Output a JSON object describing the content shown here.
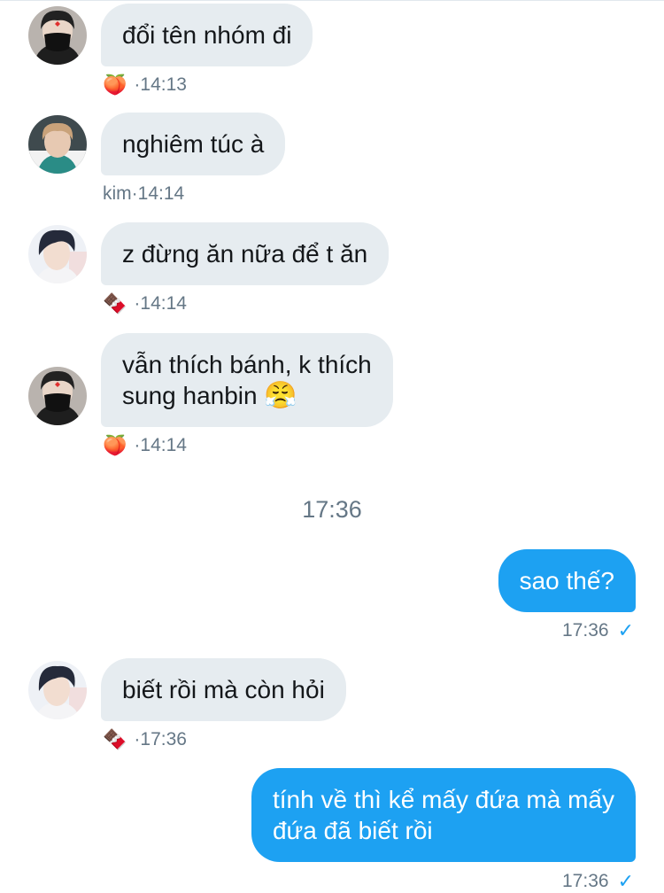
{
  "messages": [
    {
      "text": "đổi tên nhóm đi",
      "sender_icon": "🍑",
      "time": "14:13"
    },
    {
      "text": "nghiêm túc à",
      "sender": "kim",
      "time": "14:14"
    },
    {
      "text": "z đừng ăn nữa để t ăn",
      "sender_icon": "🍫",
      "time": "14:14"
    },
    {
      "line1": "vẫn thích bánh, k thích",
      "line2": "sung hanbin",
      "emoji": "😤",
      "sender_icon": "🍑",
      "time": "14:14"
    },
    {
      "text": "sao thế?",
      "time": "17:36"
    },
    {
      "text": "biết rồi mà còn hỏi",
      "sender_icon": "🍫",
      "time": "17:36"
    },
    {
      "line1": "tính về thì kể mấy đứa mà mấy",
      "line2": "đứa đã biết rồi",
      "time": "17:36"
    }
  ],
  "day_separator": "17:36",
  "meta_sep": " · ",
  "read_check": "✓",
  "colors": {
    "incoming_bubble": "#e6ecf0",
    "outgoing_bubble": "#1da1f2",
    "meta_text": "#657786"
  }
}
